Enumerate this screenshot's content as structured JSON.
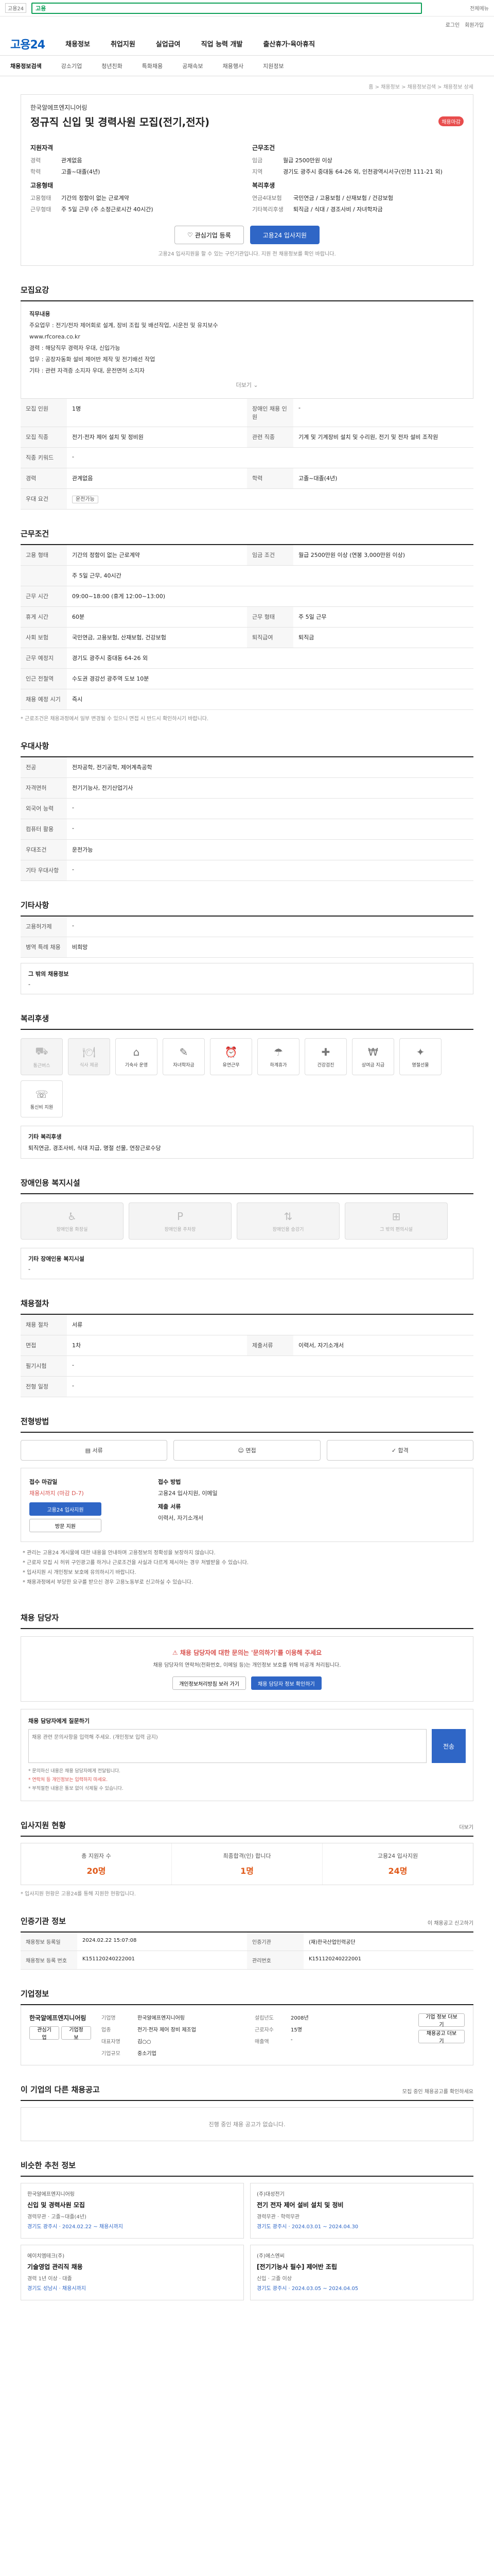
{
  "topbar": {
    "left_badge": "고용24",
    "search_text": "고용",
    "right_text": "전체메뉴"
  },
  "util": [
    "로그인",
    "회원가입"
  ],
  "gnb": {
    "logo": "고용24",
    "menus": [
      "채용정보",
      "취업지원",
      "실업급여",
      "직업 능력 개발",
      "출산휴가·육아휴직"
    ]
  },
  "lnb": [
    "채용정보검색",
    "강소기업",
    "청년친화",
    "특화채용",
    "공채속보",
    "채용행사",
    "지원정보"
  ],
  "crumb": "홈 > 채용정보 > 채용정보검색 > 채용정보 상세",
  "header": {
    "company": "한국알에프엔지니어링",
    "title": "정규직 신입 및 경력사원 모집(전기,전자)",
    "dday": "채용마감",
    "apply_label": "지원자격",
    "apply_items": [
      {
        "k": "경력",
        "v": "관계없음"
      },
      {
        "k": "학력",
        "v": "고졸~대졸(4년)"
      }
    ],
    "cond_label": "근무조건",
    "cond_items": [
      {
        "k": "임금",
        "v": "월급 2500만원 이상"
      },
      {
        "k": "지역",
        "v": "경기도 광주시 중대동 64-26 외, 인천광역시서구(인천 111-21 외)"
      }
    ],
    "type_label": "고용형태",
    "type_items": [
      {
        "k": "고용형태",
        "v": "기간의 정함이 없는 근로계약"
      },
      {
        "k": "근무형태",
        "v": "주 5일 근무 (주 소정근로시간 40시간)"
      }
    ],
    "welfare_label": "복리후생",
    "welfare_items": [
      {
        "k": "연금4대보험",
        "v": "국민연금 / 고용보험 / 산재보험 / 건강보험"
      },
      {
        "k": "기타복리후생",
        "v": "퇴직금 / 식대 / 경조사비 / 자녀학자금"
      }
    ],
    "btn_scrap": "관심기업 등록",
    "btn_apply": "고용24 입사지원",
    "note": "고용24 입사지원을 할 수 있는 구인기관입니다. 지원 전 채용정보를 확인 바랍니다."
  },
  "recruit": {
    "title": "모집요강",
    "lines": [
      "직무내용",
      "주요업무 : 전기/전자 제어회로 설계, 장비 조립 및 배선작업, 시운전 및 유지보수",
      "www.rfcorea.co.kr",
      "경력 : 해당직무 경력자 우대, 신입가능",
      "업무 : 공장자동화 설비 제어반 제작 및 전기배선 작업",
      "기타 : 관련 자격증 소지자 우대, 운전면허 소지자"
    ],
    "more": "더보기"
  },
  "recruit_grid": [
    {
      "k": "모집 인원",
      "v": "1명",
      "k2": "장애인 채용 인원",
      "v2": "-"
    },
    {
      "k": "모집 직종",
      "v": "전기·전자 제어 설치 및 정비원",
      "k2": "관련 직종",
      "v2": "기계 및 기계장비 설치 및 수리원, 전기 및 전자 설비 조작원"
    },
    {
      "k": "직종 키워드",
      "v": "-",
      "k2": "",
      "v2": ""
    },
    {
      "k": "경력",
      "v": "관계없음",
      "k2": "학력",
      "v2": "고졸~대졸(4년)"
    },
    {
      "k": "우대 요건",
      "v": "운전가능",
      "k2": "",
      "v2": ""
    }
  ],
  "work": {
    "title": "근무조건",
    "rows": [
      {
        "k": "고용 형태",
        "v": "기간의 정함이 없는 근로계약",
        "k2": "임금 조건",
        "v2": "월급 2500만원 이상 (연봉 3,000만원 이상)"
      },
      {
        "k": "",
        "v": "주 5일 근무, 40시간",
        "k2": "",
        "v2": ""
      },
      {
        "k": "근무 시간",
        "v": "09:00~18:00 (휴게 12:00~13:00)",
        "k2": "",
        "v2": ""
      },
      {
        "k": "휴게 시간",
        "v": "60분",
        "k2": "근무 형태",
        "v2": "주 5일 근무"
      },
      {
        "k": "사회 보험",
        "v": "국민연금, 고용보험, 산재보험, 건강보험",
        "k2": "퇴직급여",
        "v2": "퇴직금"
      },
      {
        "k": "근무 예정지",
        "v": "경기도 광주시 중대동 64-26 외",
        "k2": "",
        "v2": ""
      },
      {
        "k": "인근 전철역",
        "v": "수도권 경강선 광주역 도보 10분",
        "k2": "",
        "v2": ""
      },
      {
        "k": "채용 예정 시기",
        "v": "즉시",
        "k2": "",
        "v2": ""
      }
    ],
    "note": "* 근로조건은 채용과정에서 일부 변경될 수 있으니 면접 시 반드시 확인하시기 바랍니다."
  },
  "pref": {
    "title": "우대사항",
    "rows": [
      {
        "k": "전공",
        "v": "전자공학, 전기공학, 제어계측공학"
      },
      {
        "k": "자격면허",
        "v": "전기기능사, 전기산업기사"
      },
      {
        "k": "외국어 능력",
        "v": "-"
      },
      {
        "k": "컴퓨터 활용",
        "v": "-"
      },
      {
        "k": "우대조건",
        "v": "운전가능"
      },
      {
        "k": "기타 우대사항",
        "v": "-"
      }
    ]
  },
  "etc": {
    "title": "기타사항",
    "rows": [
      {
        "k": "고용허가제",
        "v": "-"
      },
      {
        "k": "병역 특례 채용",
        "v": "비희망"
      },
      {
        "k": "그 밖의 채용정보",
        "v": "-"
      }
    ]
  },
  "welfare": {
    "title": "복리후생",
    "cards": [
      {
        "icon": "car-icon",
        "glyph": "⛟",
        "label": "통근버스",
        "on": false
      },
      {
        "icon": "meal-icon",
        "glyph": "🍽",
        "label": "식사 제공",
        "on": false
      },
      {
        "icon": "house-icon",
        "glyph": "⌂",
        "label": "기숙사 운영",
        "on": true
      },
      {
        "icon": "book-icon",
        "glyph": "✎",
        "label": "자녀학자금",
        "on": true
      },
      {
        "icon": "clock-icon",
        "glyph": "⏰",
        "label": "유연근무",
        "on": true
      },
      {
        "icon": "vacation-icon",
        "glyph": "☂",
        "label": "하계휴가",
        "on": true
      },
      {
        "icon": "health-icon",
        "glyph": "✚",
        "label": "건강검진",
        "on": true
      },
      {
        "icon": "bonus-icon",
        "glyph": "₩",
        "label": "상여금 지급",
        "on": true
      },
      {
        "icon": "gift-icon",
        "glyph": "✦",
        "label": "명절선물",
        "on": true
      },
      {
        "icon": "phone-icon",
        "glyph": "☏",
        "label": "통신비 지원",
        "on": true
      }
    ],
    "etc_label": "기타 복리후생",
    "etc_value": "퇴직연금, 경조사비, 식대 지급, 명절 선물, 연장근로수당"
  },
  "disabled": {
    "title": "장애인용 복지시설",
    "cards": [
      {
        "label": "장애인용 화장실"
      },
      {
        "label": "장애인용 주차장"
      },
      {
        "label": "장애인용 승강기"
      },
      {
        "label": "그 밖의 편의시설"
      }
    ],
    "etc_label": "기타 장애인용 복지시설",
    "etc_value": "-"
  },
  "process": {
    "title": "채용절차",
    "rows": [
      {
        "k": "채용 절차",
        "v": "서류",
        "k2": "",
        "v2": ""
      },
      {
        "k": "면접",
        "v": "1차",
        "k2": "제출서류",
        "v2": "이력서, 자기소개서"
      },
      {
        "k": "필기시험",
        "v": "-",
        "k2": "",
        "v2": ""
      },
      {
        "k": "전형 일정",
        "v": "-",
        "k2": "",
        "v2": ""
      }
    ]
  },
  "apply_method": {
    "title": "전형방법",
    "sels": [
      "서류",
      "면접",
      "합격"
    ],
    "deadline_label": "접수 마감일",
    "deadline": "채용시까지 (마감 D-7)",
    "btn_apply": "고용24 입사지원",
    "btn_print": "방문 지원",
    "method_label": "접수 방법",
    "method": "고용24 입사지원, 이메일",
    "docs_label": "제출 서류",
    "docs": "이력서, 자기소개서",
    "bullets": [
      "* 관리는 고용24 게시물에 대한 내용을 안내하며 고용정보의 정확성을 보장하지 않습니다.",
      "* 근로자 모집 시 허위 구인광고를 하거나 근로조건을 사실과 다르게 제시하는 경우 처벌받을 수 있습니다.",
      "* 입사지원 시 개인정보 보호에 유의하시기 바랍니다.",
      "* 채용과정에서 부당한 요구를 받으신 경우 고용노동부로 신고하실 수 있습니다."
    ]
  },
  "contact": {
    "title": "채용 담당자",
    "warn": "채용 담당자에 대한 문의는 '문의하기'를 이용해 주세요",
    "desc": "채용 담당자의 연락처(전화번호, 이메일 등)는 개인정보 보호를 위해 비공개 처리됩니다.",
    "btn1": "개인정보처리방침 보러 가기",
    "btn2": "채용 담당자 정보 확인하기"
  },
  "question": {
    "title": "채용 담당자에게 질문하기",
    "placeholder": "채용 관련 문의사항을 입력해 주세요. (개인정보 입력 금지)",
    "submit": "전송",
    "notes": [
      "* 문의하신 내용은 채용 담당자에게 전달됩니다.",
      "* 연락처 등 개인정보는 입력하지 마세요.",
      "* 부적절한 내용은 통보 없이 삭제될 수 있습니다."
    ]
  },
  "stats": {
    "title": "입사지원 현황",
    "right": "더보기",
    "items": [
      {
        "label": "총 지원자 수",
        "num": "20명"
      },
      {
        "label": "최종합격(인) 합니다",
        "num": "1명"
      },
      {
        "label": "고용24 입사지원",
        "num": "24명"
      }
    ],
    "note": "* 입사지원 현황은 고용24를 통해 지원한 현황입니다."
  },
  "postinfo": {
    "title": "인증기관 정보",
    "right": "이 채용공고 신고하기",
    "rows": [
      {
        "k": "채용정보 등록일",
        "v": "2024.02.22 15:07:08",
        "k2": "인증기관",
        "v2": "(재)한국산업인력공단"
      },
      {
        "k": "채용정보 등록 번호",
        "v": "K151120240222001",
        "k2": "관리번호",
        "v2": "K151120240222001"
      }
    ]
  },
  "company_info": {
    "title": "기업정보",
    "name": "한국알에프엔지니어링",
    "btn1": "관심기업",
    "btn2": "기업정보",
    "items": [
      {
        "k": "기업명",
        "v": "한국알에프엔지니어링",
        "k2": "설립년도",
        "v2": "2008년"
      },
      {
        "k": "업종",
        "v": "전기·전자 제어 장비 제조업",
        "k2": "근로자수",
        "v2": "15명"
      },
      {
        "k": "대표자명",
        "v": "김○○",
        "k2": "매출액",
        "v2": "-"
      },
      {
        "k": "기업규모",
        "v": "중소기업",
        "k2": "",
        "v2": ""
      }
    ],
    "right_btns": [
      "기업 정보 더보기",
      "채용공고 더보기"
    ]
  },
  "other": {
    "title": "이 기업의 다른 채용공고",
    "right": "모집 중인 채용공고를 확인하세요",
    "empty": "진행 중인 채용 공고가 없습니다."
  },
  "recommend": {
    "title": "비슷한 추천 정보",
    "items": [
      {
        "company": "한국알에프엔지니어링",
        "title": "신입 및 경력사원 모집",
        "meta": "경력무관 · 고졸~대졸(4년)",
        "date": "경기도 광주시 · 2024.02.22 ~ 채용시까지"
      },
      {
        "company": "(주)대성전기",
        "title": "전기 전자 제어 설비 설치 및 정비",
        "meta": "경력무관 · 학력무관",
        "date": "경기도 광주시 · 2024.03.01 ~ 2024.04.30"
      },
      {
        "company": "에이치엠테크(주)",
        "title": "기술영업 관리직 채용",
        "meta": "경력 1년 이상 · 대졸",
        "date": "경기도 성남시 · 채용시까지"
      },
      {
        "company": "(주)에스엔씨",
        "title": "[전기기능사 필수] 제어반 조립",
        "meta": "신입 · 고졸 이상",
        "date": "경기도 광주시 · 2024.03.05 ~ 2024.04.05"
      }
    ]
  }
}
